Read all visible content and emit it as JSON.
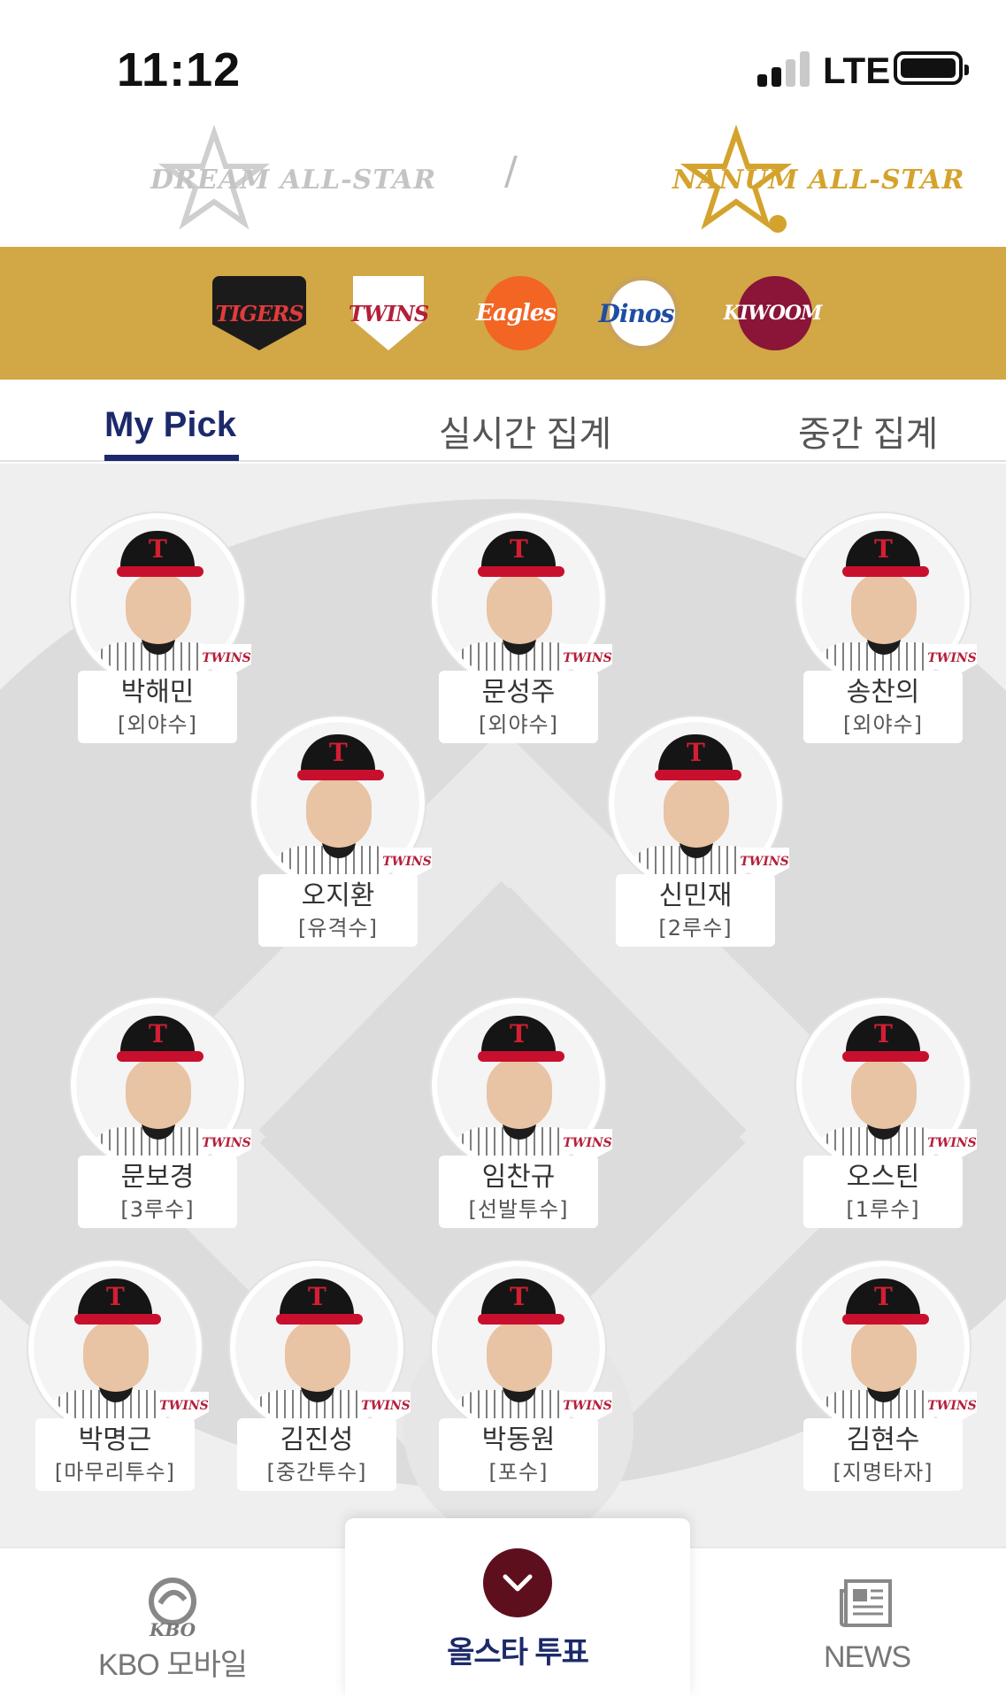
{
  "status_bar": {
    "time": "11:12",
    "network": "LTE"
  },
  "league": {
    "dream_label": "DREAM ALL-STAR",
    "separator": "/",
    "nanum_label": "NANUM ALL-STAR",
    "active": "NANUM ALL-STAR",
    "active_color": "#d4a32d"
  },
  "teams": [
    {
      "name": "TIGERS",
      "icon": "tigers-logo"
    },
    {
      "name": "TWINS",
      "icon": "twins-logo"
    },
    {
      "name": "Eagles",
      "icon": "eagles-logo"
    },
    {
      "name": "Dinos",
      "icon": "dinos-logo"
    },
    {
      "name": "KIWOOM",
      "icon": "kiwoom-logo"
    }
  ],
  "tabs": [
    {
      "label": "My Pick",
      "active": true
    },
    {
      "label": "실시간 집계",
      "active": false
    },
    {
      "label": "중간 집계",
      "active": false
    }
  ],
  "players": [
    {
      "name": "박해민",
      "position": "[외야수]",
      "team": "TWINS"
    },
    {
      "name": "문성주",
      "position": "[외야수]",
      "team": "TWINS"
    },
    {
      "name": "송찬의",
      "position": "[외야수]",
      "team": "TWINS"
    },
    {
      "name": "오지환",
      "position": "[유격수]",
      "team": "TWINS"
    },
    {
      "name": "신민재",
      "position": "[2루수]",
      "team": "TWINS"
    },
    {
      "name": "문보경",
      "position": "[3루수]",
      "team": "TWINS"
    },
    {
      "name": "임찬규",
      "position": "[선발투수]",
      "team": "TWINS"
    },
    {
      "name": "오스틴",
      "position": "[1루수]",
      "team": "TWINS"
    },
    {
      "name": "박명근",
      "position": "[마무리투수]",
      "team": "TWINS"
    },
    {
      "name": "김진성",
      "position": "[중간투수]",
      "team": "TWINS"
    },
    {
      "name": "박동원",
      "position": "[포수]",
      "team": "TWINS"
    },
    {
      "name": "김현수",
      "position": "[지명타자]",
      "team": "TWINS"
    }
  ],
  "bottom_nav": {
    "kbo_label": "KBO 모바일",
    "kbo_icon_text": "KBO",
    "vote_label": "올스타 투표",
    "news_label": "NEWS"
  },
  "colors": {
    "team_band": "#d2a745",
    "tab_active": "#1c2a6b",
    "vote_button": "#5e0f1e"
  }
}
